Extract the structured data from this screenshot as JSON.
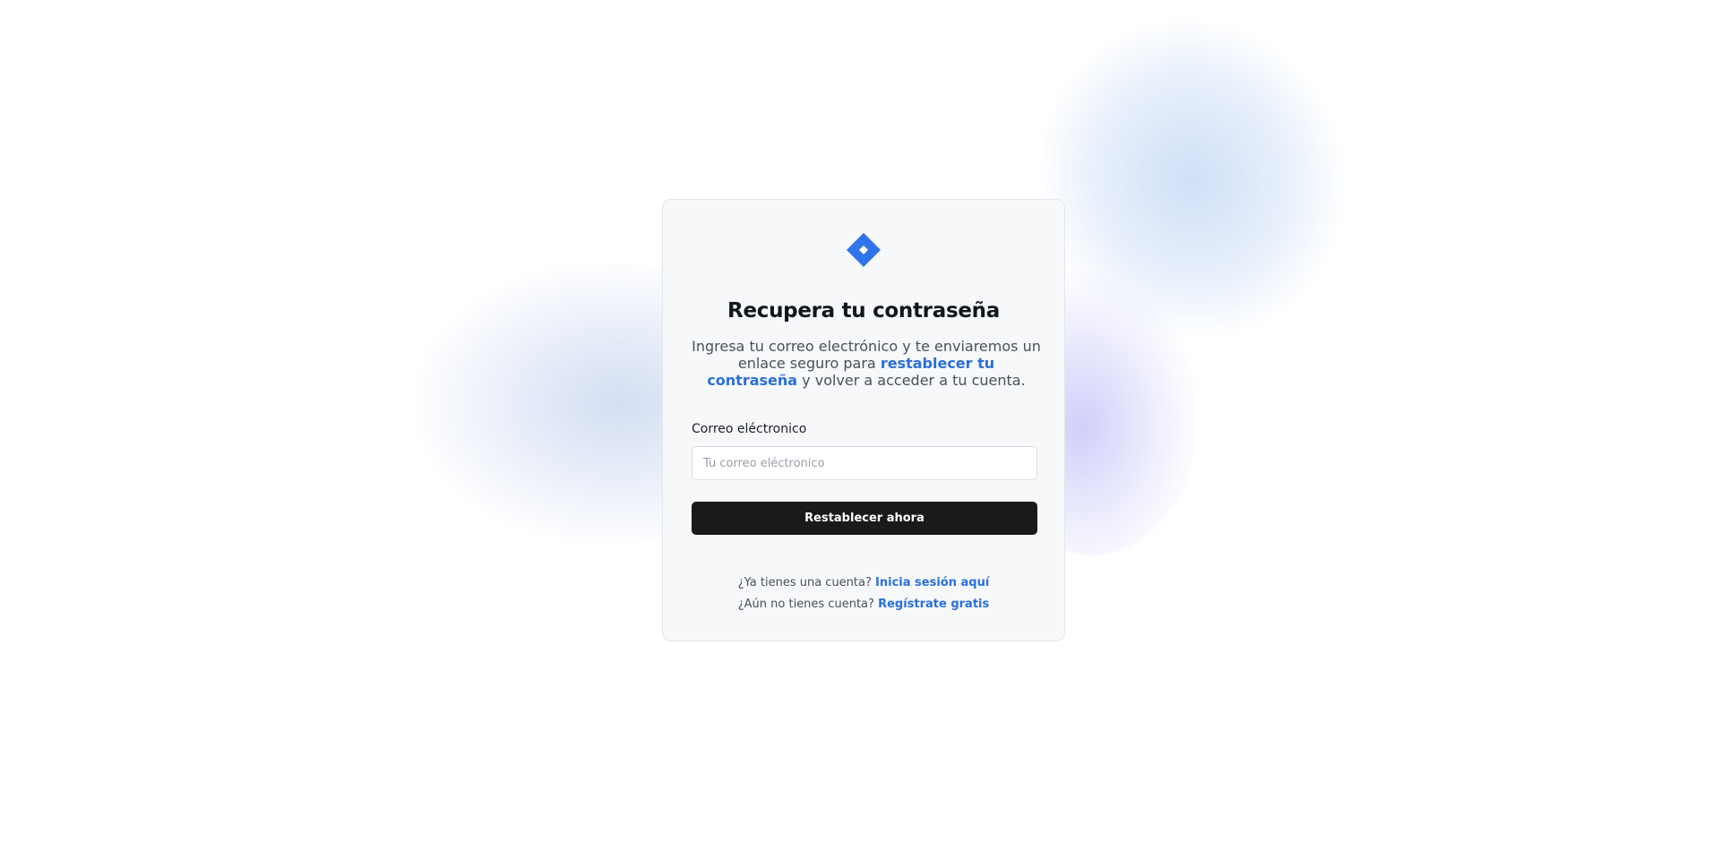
{
  "colors": {
    "accent": "#2a6fdb",
    "logo": "#2f74e8",
    "button_bg": "#1a1a1c",
    "card_bg": "#f7f8fa"
  },
  "logo": {
    "icon": "diamond-logo-icon"
  },
  "card": {
    "title": "Recupera tu contraseña",
    "description_before": "Ingresa tu correo electrónico y te enviaremos un enlace seguro para ",
    "description_link": "restablecer tu contraseña",
    "description_after": " y volver a acceder a tu cuenta."
  },
  "form": {
    "email_label": "Correo eléctronico",
    "email_placeholder": "Tu correo eléctronico",
    "email_value": "",
    "submit_label": "Restablecer ahora"
  },
  "footer": {
    "login_prompt": "¿Ya tienes una cuenta? ",
    "login_link": "Inicia sesión aquí",
    "register_prompt": "¿Aún no tienes cuenta? ",
    "register_link": "Regístrate gratis"
  }
}
